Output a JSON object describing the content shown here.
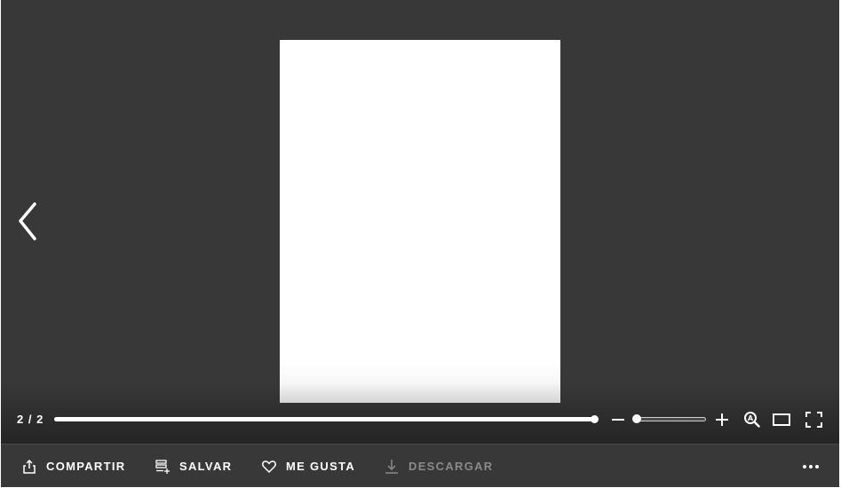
{
  "viewer": {
    "page_counter": "2 / 2",
    "current_page": 2,
    "total_pages": 2,
    "progress_fraction": 1.0,
    "zoom_fraction": 0.02
  },
  "actions": {
    "share_label": "COMPARTIR",
    "save_label": "SALVAR",
    "like_label": "ME GUSTA",
    "download_label": "DESCARGAR"
  },
  "colors": {
    "viewer_background": "#383838",
    "text": "#ffffff",
    "disabled_text": "#8a8a8a"
  },
  "icons": {
    "prev": "chevron-left-icon",
    "zoom_out": "minus-icon",
    "zoom_in": "plus-icon",
    "zoom_lens": "magnifier-icon",
    "fit": "fit-width-icon",
    "fullscreen": "fullscreen-icon",
    "share": "share-icon",
    "save": "save-list-icon",
    "like": "heart-icon",
    "download": "download-icon",
    "more": "more-dots-icon"
  }
}
